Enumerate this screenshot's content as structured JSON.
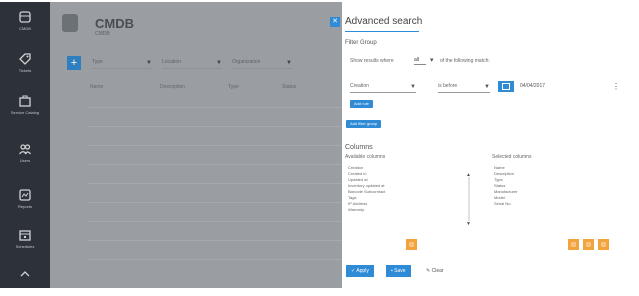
{
  "sidebar": {
    "items": [
      {
        "label": "CMDB",
        "icon": "database-icon"
      },
      {
        "label": "Tickets",
        "icon": "tag-icon"
      },
      {
        "label": "Service Catalog",
        "icon": "briefcase-icon"
      },
      {
        "label": "Users",
        "icon": "users-icon"
      },
      {
        "label": "Reports",
        "icon": "chart-icon"
      },
      {
        "label": "Schedules",
        "icon": "calendar-icon"
      },
      {
        "label": "",
        "icon": "more-icon"
      }
    ]
  },
  "main": {
    "title": "CMDB",
    "subtitle": "CMDB",
    "add_label": "+",
    "filters": [
      "Type",
      "Location",
      "Organization"
    ],
    "columns": [
      "Name",
      "Description",
      "Type",
      "Status"
    ],
    "rows": [
      [
        "",
        "",
        "",
        "",
        ""
      ],
      [
        "",
        "",
        "",
        "",
        ""
      ],
      [
        "",
        "",
        "",
        "",
        ""
      ],
      [
        "",
        "",
        "",
        "",
        ""
      ],
      [
        "",
        "",
        "",
        "",
        ""
      ],
      [
        "",
        "",
        "",
        "",
        ""
      ],
      [
        "",
        "",
        "",
        "",
        ""
      ],
      [
        "",
        "",
        "",
        "",
        ""
      ],
      [
        "",
        "",
        "",
        "",
        ""
      ]
    ]
  },
  "panel": {
    "title": "Advanced search",
    "group_title": "Filter Group",
    "match_prefix": "Show results where",
    "match_value": "all",
    "match_suffix": "of the following match:",
    "condition": {
      "field": "Creation",
      "operator": "is before",
      "value": "04/04/2017"
    },
    "add_condition_label": "Add rule",
    "add_group_label": "Add filter group",
    "columns_title": "Columns",
    "available_label": "Available columns",
    "selected_label": "Selected columns",
    "available": [
      "Creation",
      "Created in",
      "Updated at",
      "Inventory updated at",
      "Barcode Subcontract",
      "Tags",
      "IP Address",
      "Warranty"
    ],
    "selected": [
      "Name",
      "Description",
      "Type",
      "Status",
      "Manufacturer",
      "Model",
      "Serial No."
    ],
    "apply_label": "Apply",
    "save_label": "Save",
    "clear_label": "Clear"
  },
  "colors": {
    "accent": "#2f8bd6",
    "sidebar": "#2d3138",
    "orange": "#f2a33c",
    "overlay": "#9a9ea3"
  }
}
